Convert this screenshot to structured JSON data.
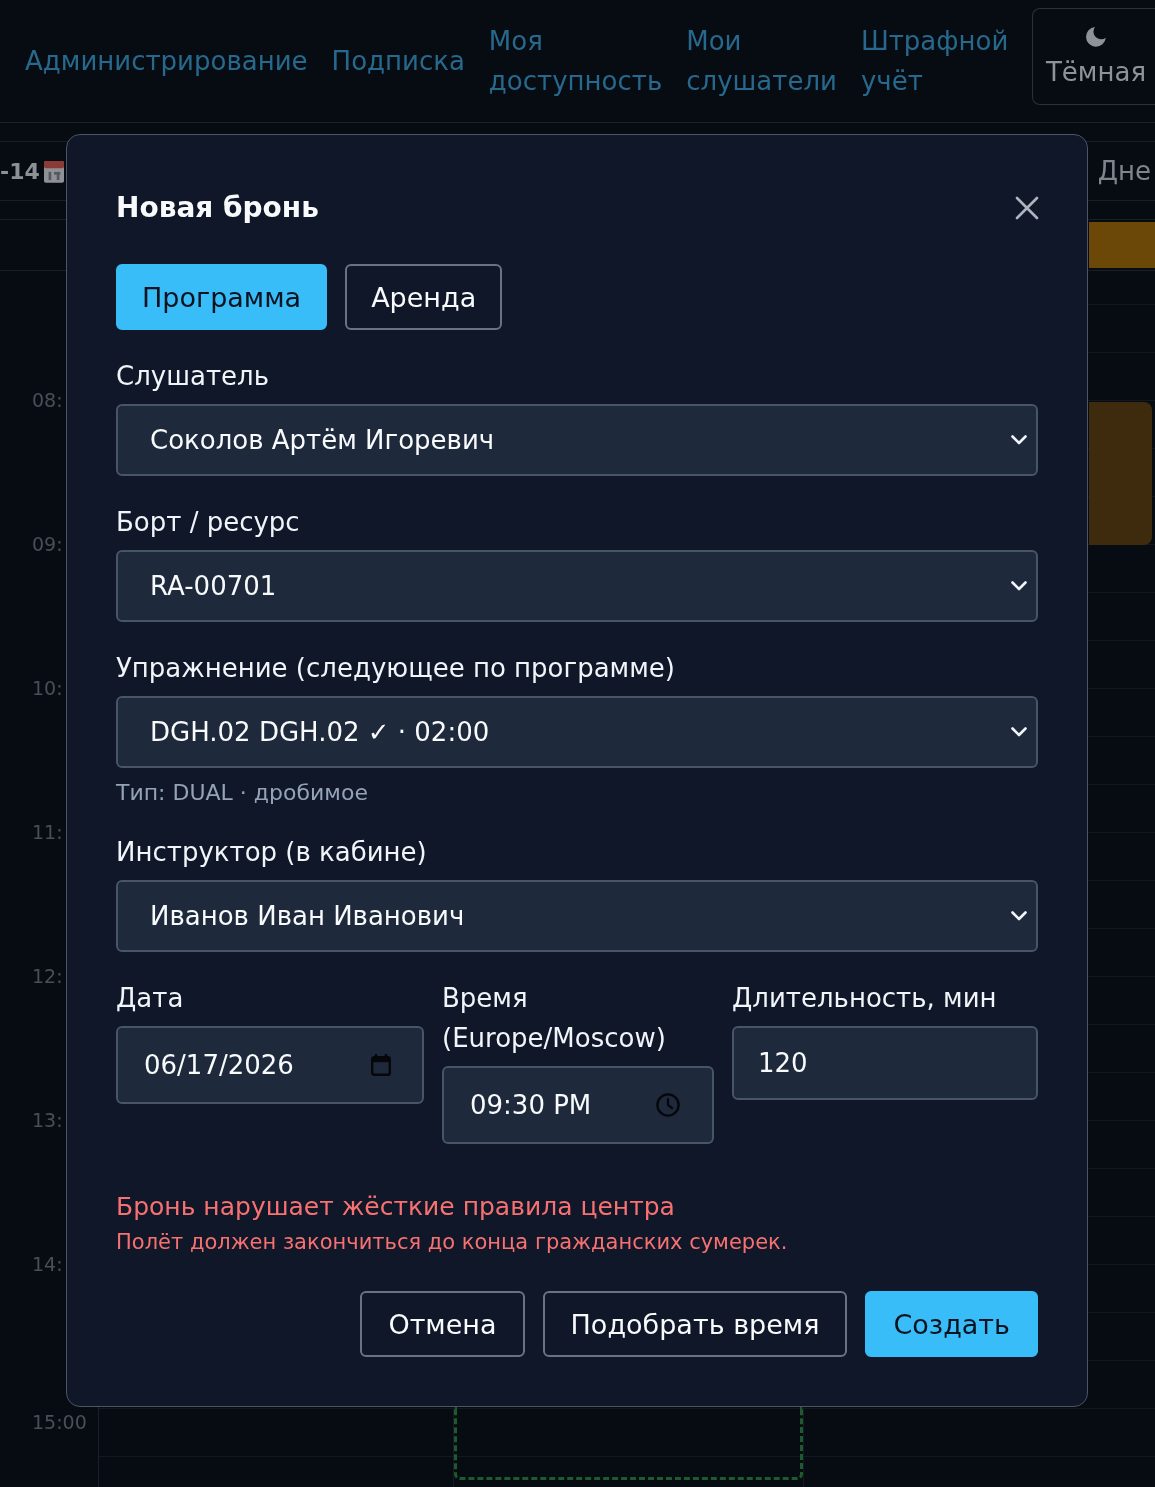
{
  "nav": {
    "links": [
      "Администрирование",
      "Подписка",
      "Моя доступность",
      "Мои слушатели",
      "Штрафной учёт"
    ],
    "theme_toggle": "Тёмная"
  },
  "calendar": {
    "range_label": "-14",
    "view_label": "Дне",
    "time_labels": [
      "08:",
      "09:",
      "10:",
      "11:",
      "12:",
      "13:",
      "14:",
      "15:00"
    ]
  },
  "modal": {
    "title": "Новая бронь",
    "tabs": [
      {
        "label": "Программа",
        "selected": true
      },
      {
        "label": "Аренда",
        "selected": false
      }
    ],
    "fields": [
      {
        "kind": "select",
        "label": "Слушатель",
        "value": "Соколов Артём Игоревич"
      },
      {
        "kind": "select",
        "label": "Борт / ресурс",
        "value": "RA-00701"
      },
      {
        "kind": "select",
        "label": "Упражнение (следующее по программе)",
        "value": "DGH.02 DGH.02 ✓ · 02:00",
        "hint": "Тип: DUAL · дробимое"
      },
      {
        "kind": "select",
        "label": "Инструктор (в кабине)",
        "value": "Иванов Иван Иванович"
      }
    ],
    "row_fields": [
      {
        "kind": "date",
        "label": "Дата",
        "value": "06/17/2026"
      },
      {
        "kind": "time",
        "label": "Время (Europe/Moscow)",
        "value": "09:30 PM"
      },
      {
        "kind": "number",
        "label": "Длительность, мин",
        "value": "120"
      }
    ],
    "error": {
      "title": "Бронь нарушает жёсткие правила центра",
      "message": "Полёт должен закончиться до конца гражданских сумерек."
    },
    "buttons": [
      {
        "label": "Отмена",
        "kind": "secondary"
      },
      {
        "label": "Подобрать время",
        "kind": "secondary"
      },
      {
        "label": "Создать",
        "kind": "primary"
      }
    ]
  }
}
